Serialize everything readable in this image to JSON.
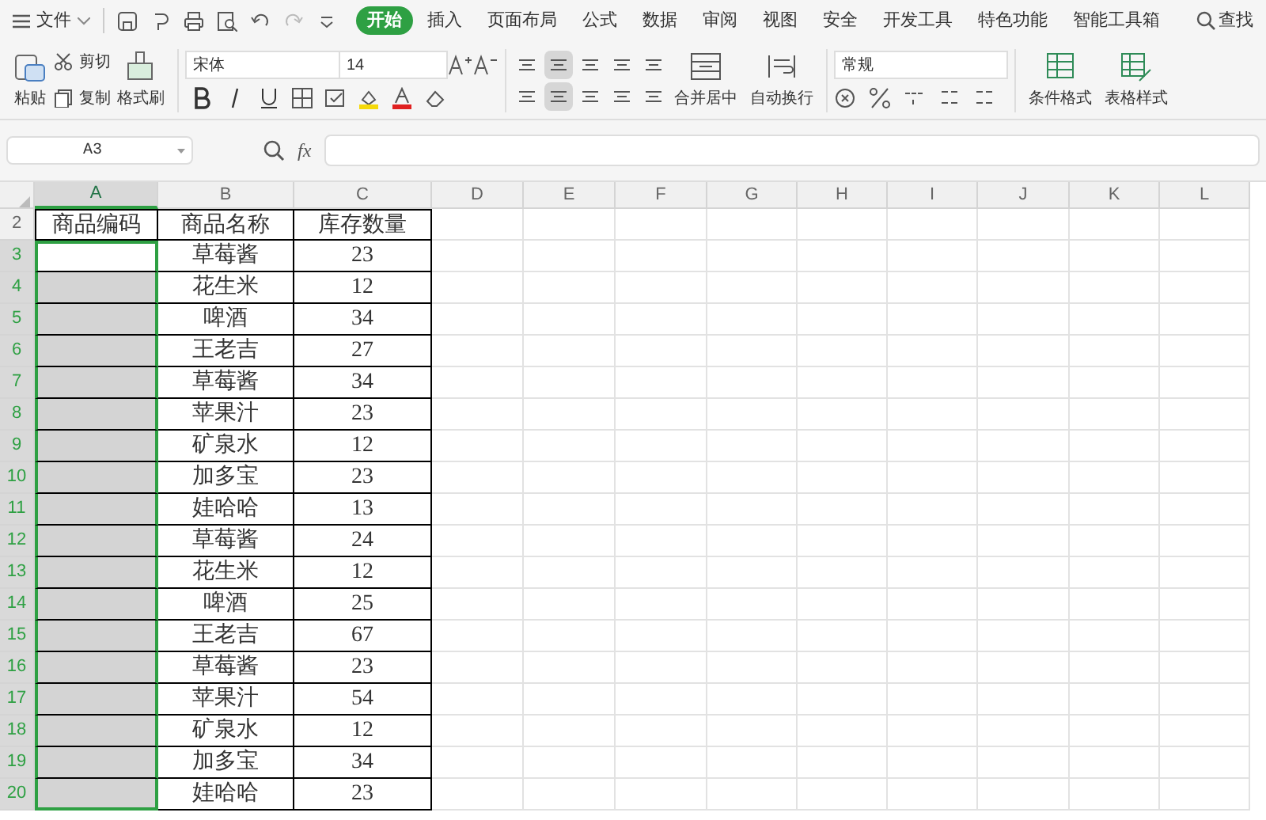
{
  "menu": {
    "file": "文件"
  },
  "tabs": [
    {
      "label": "开始",
      "selected": true
    },
    {
      "label": "插入",
      "selected": false
    },
    {
      "label": "页面布局",
      "selected": false
    },
    {
      "label": "公式",
      "selected": false
    },
    {
      "label": "数据",
      "selected": false
    },
    {
      "label": "审阅",
      "selected": false
    },
    {
      "label": "视图",
      "selected": false
    },
    {
      "label": "安全",
      "selected": false
    },
    {
      "label": "开发工具",
      "selected": false
    },
    {
      "label": "特色功能",
      "selected": false
    },
    {
      "label": "智能工具箱",
      "selected": false
    }
  ],
  "search": "查找",
  "ribbon": {
    "paste": "粘贴",
    "cut": "剪切",
    "copy": "复制",
    "format_painter": "格式刷",
    "font": "宋体",
    "font_size": "14",
    "merge": "合并居中",
    "wrap": "自动换行",
    "number_format": "常规",
    "conditional_format": "条件格式",
    "table_style": "表格样式",
    "alignment": [
      {
        "selected": false
      },
      {
        "selected": true
      },
      {
        "selected": false
      },
      {
        "selected": false
      },
      {
        "selected": false
      },
      {
        "selected": false
      },
      {
        "selected": true
      },
      {
        "selected": false
      },
      {
        "selected": false
      },
      {
        "selected": false
      }
    ]
  },
  "name_box": "A3",
  "fx": "fx",
  "sheet": {
    "columns": [
      {
        "label": "A",
        "selected": true
      },
      {
        "label": "B",
        "selected": false
      },
      {
        "label": "C",
        "selected": false
      },
      {
        "label": "D",
        "selected": false
      },
      {
        "label": "E",
        "selected": false
      },
      {
        "label": "F",
        "selected": false
      },
      {
        "label": "G",
        "selected": false
      },
      {
        "label": "H",
        "selected": false
      },
      {
        "label": "I",
        "selected": false
      },
      {
        "label": "J",
        "selected": false
      },
      {
        "label": "K",
        "selected": false
      },
      {
        "label": "L",
        "selected": false
      }
    ],
    "rows": [
      {
        "number": "2",
        "selected": false,
        "cells": [
          "商品编码",
          "商品名称",
          "库存数量"
        ]
      },
      {
        "number": "3",
        "selected": true,
        "cells": [
          "",
          "草莓酱",
          "23"
        ]
      },
      {
        "number": "4",
        "selected": true,
        "cells": [
          "",
          "花生米",
          "12"
        ]
      },
      {
        "number": "5",
        "selected": true,
        "cells": [
          "",
          "啤酒",
          "34"
        ]
      },
      {
        "number": "6",
        "selected": true,
        "cells": [
          "",
          "王老吉",
          "27"
        ]
      },
      {
        "number": "7",
        "selected": true,
        "cells": [
          "",
          "草莓酱",
          "34"
        ]
      },
      {
        "number": "8",
        "selected": true,
        "cells": [
          "",
          "苹果汁",
          "23"
        ]
      },
      {
        "number": "9",
        "selected": true,
        "cells": [
          "",
          "矿泉水",
          "12"
        ]
      },
      {
        "number": "10",
        "selected": true,
        "cells": [
          "",
          "加多宝",
          "23"
        ]
      },
      {
        "number": "11",
        "selected": true,
        "cells": [
          "",
          "娃哈哈",
          "13"
        ]
      },
      {
        "number": "12",
        "selected": true,
        "cells": [
          "",
          "草莓酱",
          "24"
        ]
      },
      {
        "number": "13",
        "selected": true,
        "cells": [
          "",
          "花生米",
          "12"
        ]
      },
      {
        "number": "14",
        "selected": true,
        "cells": [
          "",
          "啤酒",
          "25"
        ]
      },
      {
        "number": "15",
        "selected": true,
        "cells": [
          "",
          "王老吉",
          "67"
        ]
      },
      {
        "number": "16",
        "selected": true,
        "cells": [
          "",
          "草莓酱",
          "23"
        ]
      },
      {
        "number": "17",
        "selected": true,
        "cells": [
          "",
          "苹果汁",
          "54"
        ]
      },
      {
        "number": "18",
        "selected": true,
        "cells": [
          "",
          "矿泉水",
          "12"
        ]
      },
      {
        "number": "19",
        "selected": true,
        "cells": [
          "",
          "加多宝",
          "34"
        ]
      },
      {
        "number": "20",
        "selected": true,
        "cells": [
          "",
          "娃哈哈",
          "23"
        ]
      }
    ]
  }
}
